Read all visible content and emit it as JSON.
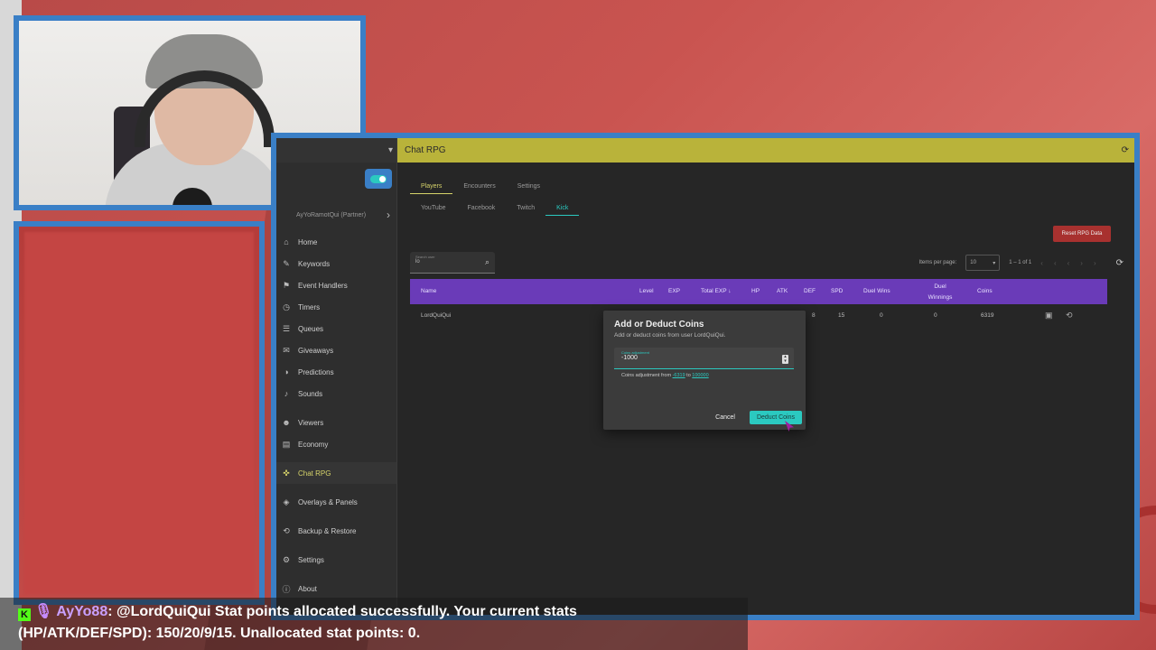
{
  "app": {
    "window_title": "Chat RPG",
    "user_label": "AyYoRamotQui (Partner)",
    "nav": [
      {
        "icon": "home-icon",
        "glyph": "⌂",
        "label": "Home"
      },
      {
        "icon": "keywords-icon",
        "glyph": "✎",
        "label": "Keywords"
      },
      {
        "icon": "flag-icon",
        "glyph": "⚑",
        "label": "Event Handlers"
      },
      {
        "icon": "timer-icon",
        "glyph": "◷",
        "label": "Timers"
      },
      {
        "icon": "list-icon",
        "glyph": "☰",
        "label": "Queues"
      },
      {
        "icon": "gift-icon",
        "glyph": "✉",
        "label": "Giveaways"
      },
      {
        "icon": "predictions-icon",
        "glyph": "◑",
        "label": "Predictions"
      },
      {
        "icon": "sound-icon",
        "glyph": "♪",
        "label": "Sounds"
      },
      {
        "icon": "viewers-icon",
        "glyph": "☻",
        "label": "Viewers"
      },
      {
        "icon": "store-icon",
        "glyph": "▤",
        "label": "Economy"
      },
      {
        "icon": "gamepad-icon",
        "glyph": "✜",
        "label": "Chat RPG"
      },
      {
        "icon": "layers-icon",
        "glyph": "◈",
        "label": "Overlays & Panels"
      },
      {
        "icon": "backup-icon",
        "glyph": "⟲",
        "label": "Backup & Restore"
      },
      {
        "icon": "gear-icon",
        "glyph": "⚙",
        "label": "Settings"
      },
      {
        "icon": "info-icon",
        "glyph": "ⓘ",
        "label": "About"
      }
    ],
    "active_nav": "Chat RPG"
  },
  "main": {
    "tabs": [
      "Players",
      "Encounters",
      "Settings"
    ],
    "active_tab": "Players",
    "subtabs": [
      "YouTube",
      "Facebook",
      "Twitch",
      "Kick"
    ],
    "active_subtab": "Kick",
    "reset_button": "Reset RPG Data",
    "search": {
      "label": "Search user",
      "value": "lo"
    },
    "pager": {
      "items_label": "Items per page:",
      "items_value": "10",
      "range": "1 – 1 of 1"
    },
    "table": {
      "columns": [
        "Name",
        "Level",
        "EXP",
        "Total EXP ↓",
        "HP",
        "ATK",
        "DEF",
        "SPD",
        "Duel Wins",
        "Duel Winnings",
        "Coins"
      ],
      "rows": [
        {
          "name": "LordQuiQui",
          "def": "8",
          "spd": "15",
          "duel_wins": "0",
          "duel_winnings": "0",
          "coins": "6319"
        }
      ]
    }
  },
  "dialog": {
    "title": "Add or Deduct Coins",
    "subtitle": "Add or deduct coins from user LordQuiQui.",
    "field_label": "Coins adjustment",
    "field_value": "-1000",
    "hint_prefix": "Coins adjustment from",
    "hint_min": "-6319",
    "hint_to": "to",
    "hint_max": "100000",
    "cancel_label": "Cancel",
    "confirm_label": "Deduct Coins"
  },
  "chat": {
    "platform_badge": "K",
    "username": "AyYo88",
    "message_line1": ": @LordQuiQui Stat points allocated successfully. Your current stats",
    "message_line2": "(HP/ATK/DEF/SPD): 150/20/9/15. Unallocated stat points: 0."
  },
  "colors": {
    "accent_yellow": "#b9b33a",
    "accent_teal": "#2bc9c0",
    "table_header": "#6a3bb8",
    "danger": "#a8312f",
    "frame_blue": "#3a7fc6"
  }
}
